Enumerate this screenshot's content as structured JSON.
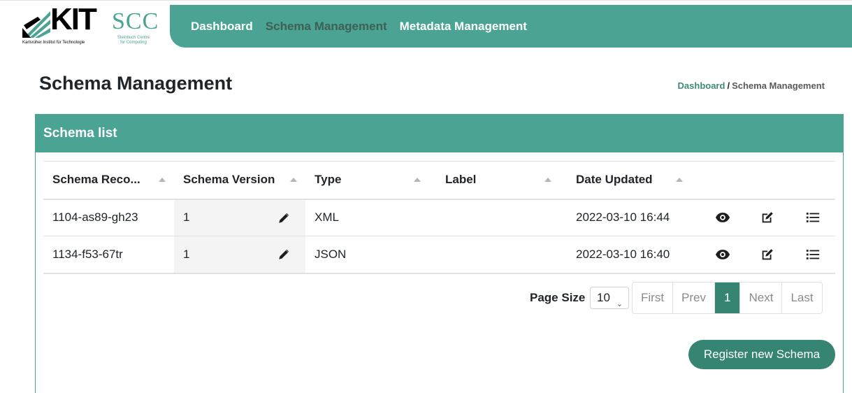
{
  "brand": {
    "kit_wordmark": "KIT",
    "kit_subtitle": "Karlsruher Institut für Technologie",
    "scc_wordmark": "SCC",
    "scc_subtitle_1": "Steinbuch Centre",
    "scc_subtitle_2": "for Computing",
    "accent_color": "#4aa393",
    "dark_accent_color": "#358572"
  },
  "nav": {
    "items": [
      {
        "label": "Dashboard",
        "active": false
      },
      {
        "label": "Schema Management",
        "active": true
      },
      {
        "label": "Metadata Management",
        "active": false
      }
    ]
  },
  "page": {
    "title": "Schema Management",
    "breadcrumb": {
      "link": "Dashboard",
      "separator": "/",
      "current": "Schema Management"
    }
  },
  "card": {
    "title": "Schema list",
    "columns": [
      "Schema Reco...",
      "Schema Version",
      "Type",
      "Label",
      "Date Updated"
    ],
    "rows": [
      {
        "record": "1104-as89-gh23",
        "version": "1",
        "type": "XML",
        "label": "",
        "date": "2022-03-10 16:44"
      },
      {
        "record": "1134-f53-67tr",
        "version": "1",
        "type": "JSON",
        "label": "",
        "date": "2022-03-10 16:40"
      }
    ],
    "row_action_icons": [
      "eye-icon",
      "edit-icon",
      "list-icon"
    ]
  },
  "pagination": {
    "page_size_label": "Page Size",
    "page_size_value": "10",
    "first": "First",
    "prev": "Prev",
    "current": "1",
    "next": "Next",
    "last": "Last"
  },
  "actions": {
    "register_label": "Register new Schema"
  }
}
